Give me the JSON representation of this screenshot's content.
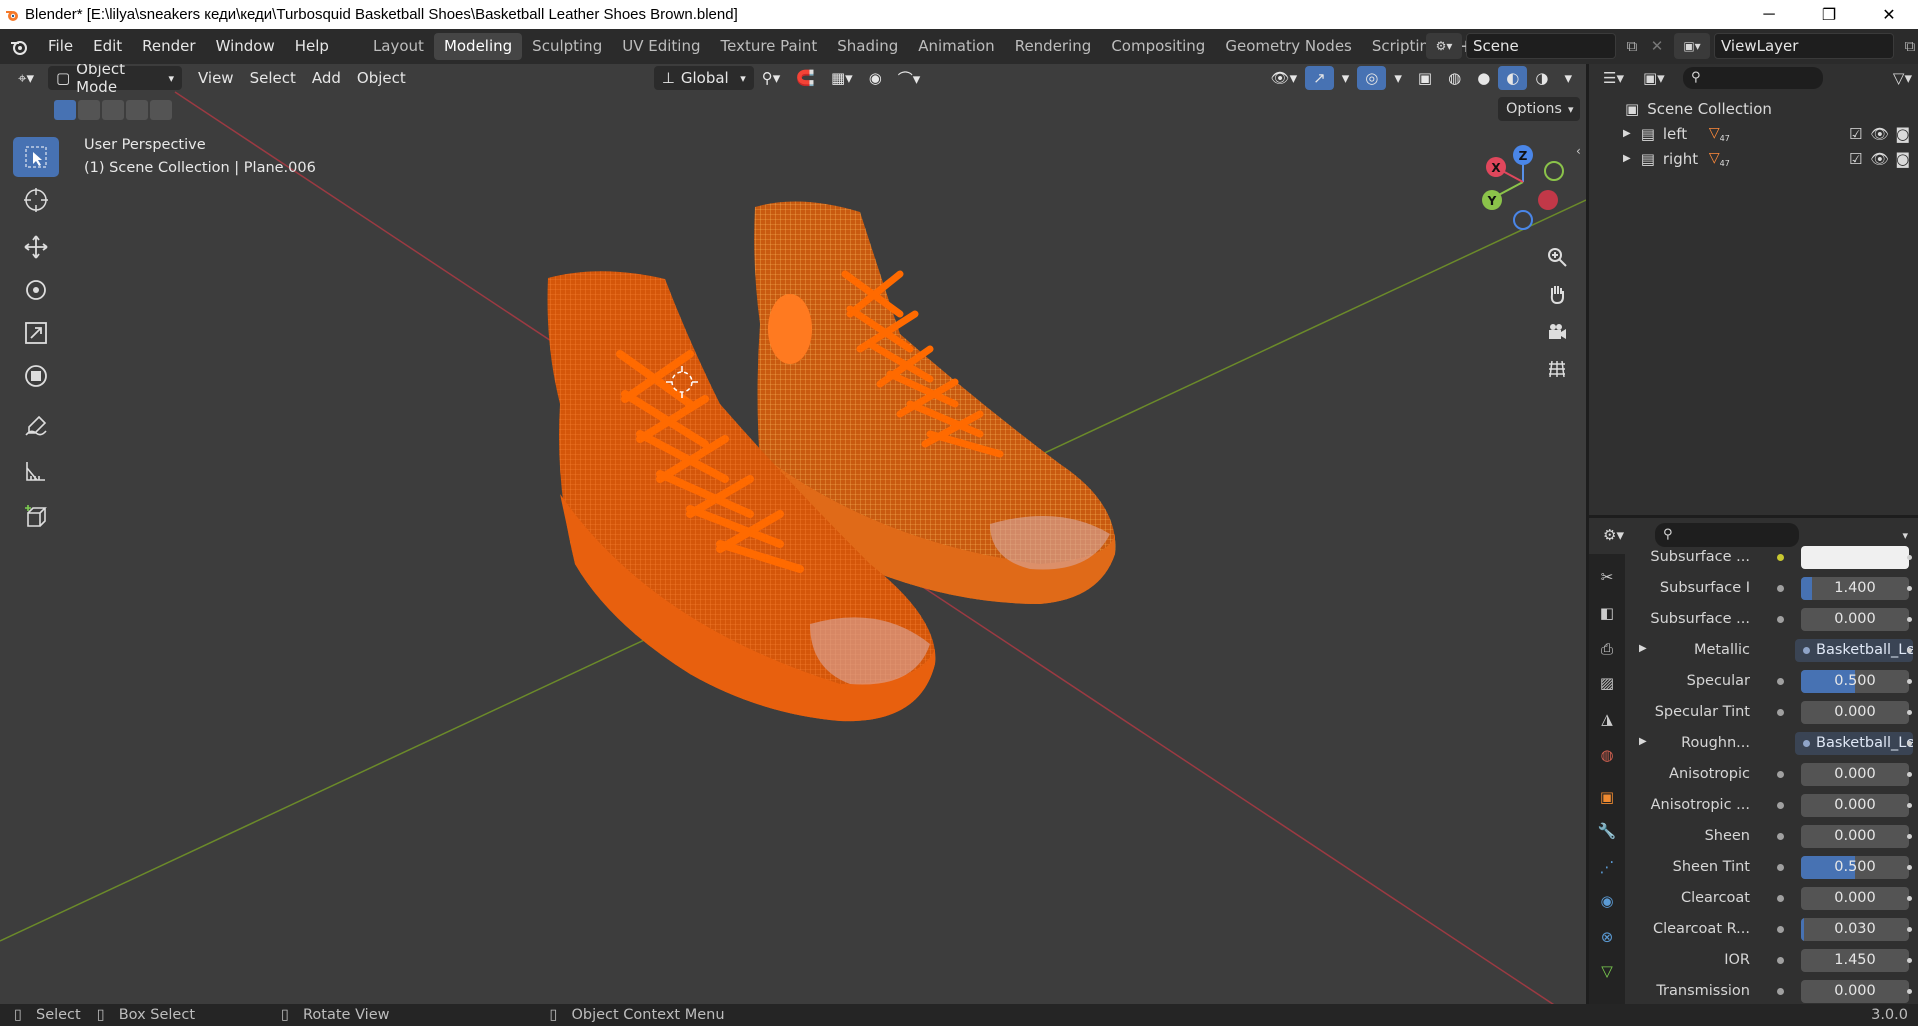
{
  "title_bar": {
    "title": "Blender* [E:\\lilya\\sneakers кеди\\кеди\\Turbosquid Basketball Shoes\\Basketball Leather Shoes Brown.blend]",
    "minimize": "─",
    "restore": "❐",
    "close": "✕"
  },
  "menus": [
    "File",
    "Edit",
    "Render",
    "Window",
    "Help"
  ],
  "workspaces": {
    "tabs": [
      "Layout",
      "Modeling",
      "Sculpting",
      "UV Editing",
      "Texture Paint",
      "Shading",
      "Animation",
      "Rendering",
      "Compositing",
      "Geometry Nodes",
      "Scripting"
    ],
    "active": "Modeling",
    "add": "+"
  },
  "scene": {
    "name": "Scene"
  },
  "view_layer": {
    "name": "ViewLayer"
  },
  "viewport": {
    "mode": "Object Mode",
    "menus": [
      "View",
      "Select",
      "Add",
      "Object"
    ],
    "orientation": "Global",
    "options": "Options",
    "overlay_title": "User Perspective",
    "overlay_subtitle": "(1) Scene Collection | Plane.006",
    "gizmo": {
      "x": "X",
      "y": "Y",
      "z": "Z"
    },
    "accent_color": "#ff6a00",
    "selection_color": "#ffa030"
  },
  "outliner": {
    "root": "Scene Collection",
    "items": [
      {
        "name": "left",
        "badge": "47"
      },
      {
        "name": "right",
        "badge": "47"
      }
    ]
  },
  "properties": {
    "rows": [
      {
        "label": "Subsurface ...",
        "type": "color",
        "value": ""
      },
      {
        "label": "Subsurface I",
        "type": "value",
        "value": "1.400",
        "fill": 0.1
      },
      {
        "label": "Subsurface ...",
        "type": "value",
        "value": "0.000",
        "fill": 0
      },
      {
        "label": "Metallic",
        "type": "link",
        "value": "Basketball_Lea..."
      },
      {
        "label": "Specular",
        "type": "value",
        "value": "0.500",
        "fill": 0.5
      },
      {
        "label": "Specular Tint",
        "type": "value",
        "value": "0.000",
        "fill": 0
      },
      {
        "label": "Roughn...",
        "type": "link",
        "value": "Basketball_Lea..."
      },
      {
        "label": "Anisotropic",
        "type": "value",
        "value": "0.000",
        "fill": 0
      },
      {
        "label": "Anisotropic ...",
        "type": "value",
        "value": "0.000",
        "fill": 0
      },
      {
        "label": "Sheen",
        "type": "value",
        "value": "0.000",
        "fill": 0
      },
      {
        "label": "Sheen Tint",
        "type": "value",
        "value": "0.500",
        "fill": 0.5
      },
      {
        "label": "Clearcoat",
        "type": "value",
        "value": "0.000",
        "fill": 0
      },
      {
        "label": "Clearcoat R...",
        "type": "value",
        "value": "0.030",
        "fill": 0.03
      },
      {
        "label": "IOR",
        "type": "value",
        "value": "1.450",
        "fill": 0
      },
      {
        "label": "Transmission",
        "type": "value",
        "value": "0.000",
        "fill": 0
      }
    ]
  },
  "status_bar": {
    "select": "Select",
    "box_select": "Box Select",
    "rotate_view": "Rotate View",
    "context_menu": "Object Context Menu",
    "version": "3.0.0"
  }
}
